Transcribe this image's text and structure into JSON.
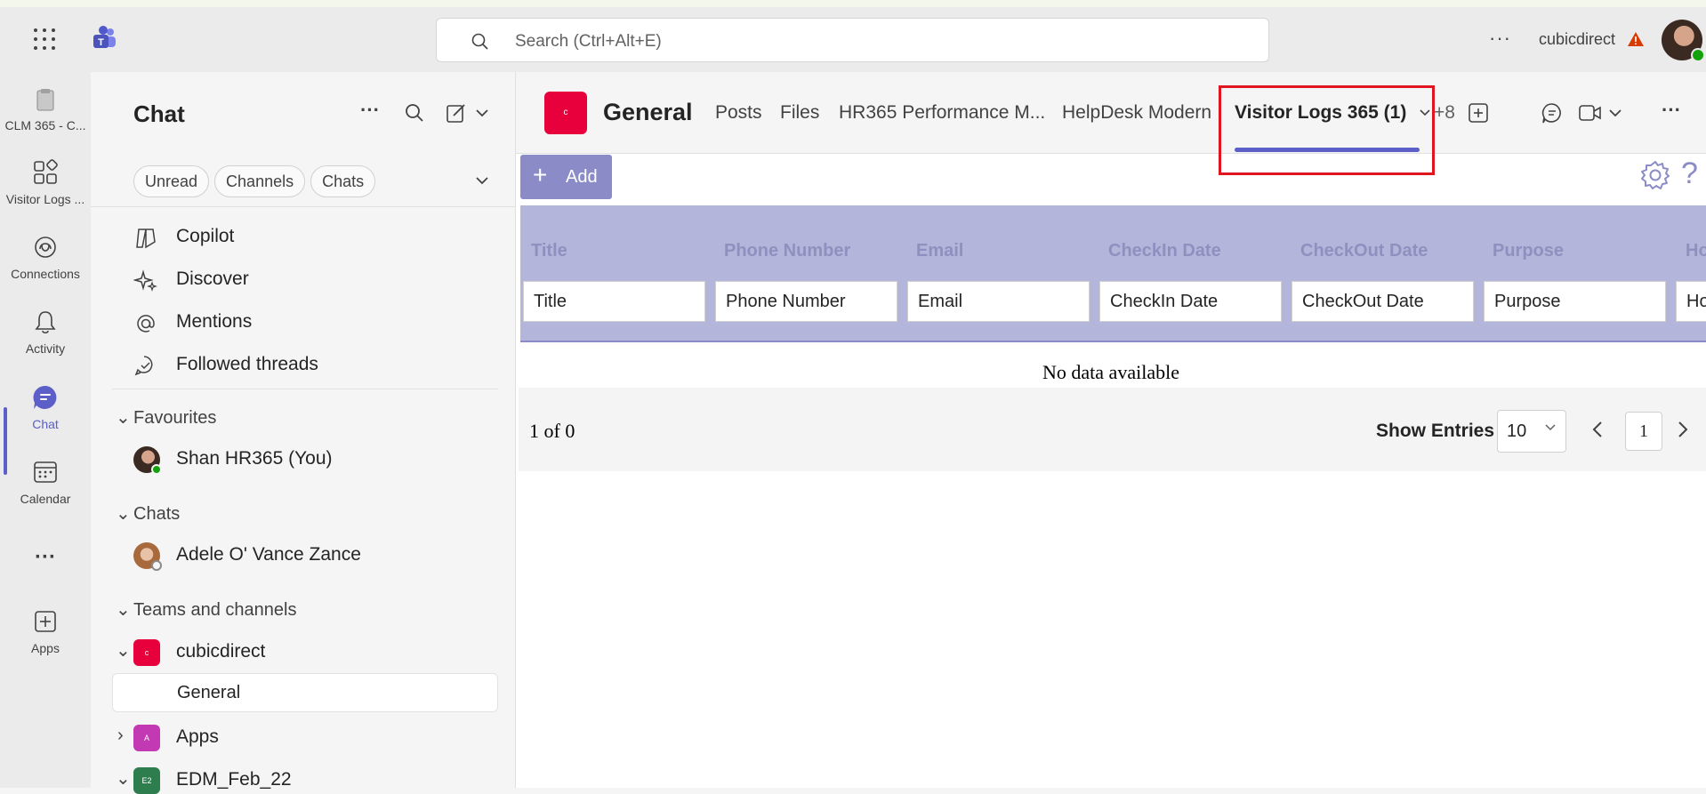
{
  "titlebar": {
    "search_placeholder": "Search (Ctrl+Alt+E)",
    "more": "···",
    "org_name": "cubicdirect"
  },
  "rail": {
    "items": [
      {
        "label": "CLM 365 - C...",
        "icon": "clipboard-icon"
      },
      {
        "label": "Visitor Logs ...",
        "icon": "apps-grid-icon"
      },
      {
        "label": "Connections",
        "icon": "connections-icon"
      },
      {
        "label": "Activity",
        "icon": "bell-icon"
      },
      {
        "label": "Chat",
        "icon": "chat-icon",
        "active": true
      },
      {
        "label": "Calendar",
        "icon": "calendar-icon"
      },
      {
        "label": "···",
        "icon": "more-icon"
      },
      {
        "label": "Apps",
        "icon": "add-app-icon"
      }
    ]
  },
  "chat_panel": {
    "title": "Chat",
    "filters": [
      "Unread",
      "Channels",
      "Chats"
    ],
    "quick_links": [
      "Copilot",
      "Discover",
      "Mentions",
      "Followed threads"
    ],
    "favourites_header": "Favourites",
    "favourites": [
      "Shan HR365 (You)"
    ],
    "chats_header": "Chats",
    "chats": [
      "Adele O' Vance Zance"
    ],
    "teams_header": "Teams and channels",
    "teams": [
      {
        "name": "cubicdirect",
        "badge": "c",
        "color": "#e8003d"
      },
      {
        "name": "Apps",
        "badge": "A",
        "color": "#c239b3"
      },
      {
        "name": "EDM_Feb_22",
        "badge": "E2",
        "color": "#2e7d4f"
      }
    ],
    "channel_selected": "General"
  },
  "channel": {
    "logo_letter": "c",
    "name": "General",
    "tabs": [
      "Posts",
      "Files",
      "HR365 Performance M...",
      "HelpDesk Modern",
      "Visitor Logs 365 (1)"
    ],
    "more_tabs": "+8",
    "more": "···"
  },
  "app": {
    "add_label": "Add",
    "help": "?",
    "columns": [
      "Title",
      "Phone Number",
      "Email",
      "CheckIn Date",
      "CheckOut Date",
      "Purpose",
      "Ho"
    ],
    "empty_text": "No data available",
    "page_count": "1 of 0",
    "show_entries_label": "Show Entries",
    "entries_value": "10",
    "current_page": "1"
  }
}
